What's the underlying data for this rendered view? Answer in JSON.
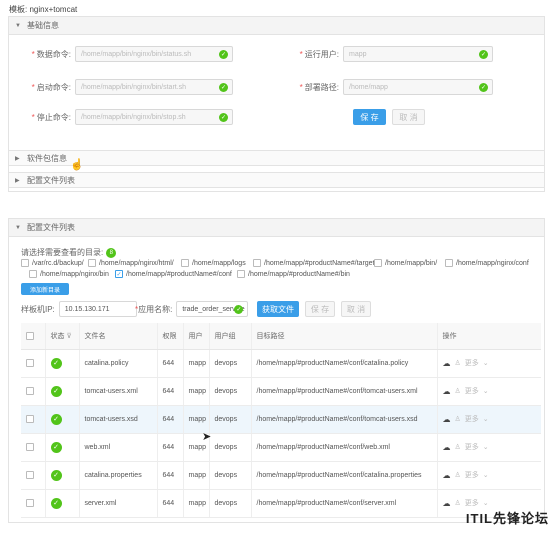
{
  "template": {
    "title": "模板: nginx+tomcat"
  },
  "basic_info": {
    "title": "基础信息",
    "fields": {
      "status_cmd": {
        "label": "数据命令:",
        "value": "/home/mapp/bin/nginx/bin/status.sh"
      },
      "start_cmd": {
        "label": "启动命令:",
        "value": "/home/mapp/bin/nginx/bin/start.sh"
      },
      "stop_cmd": {
        "label": "停止命令:",
        "value": "/home/mapp/bin/nginx/bin/stop.sh"
      },
      "run_user": {
        "label": "运行用户:",
        "value": "mapp"
      },
      "deploy_path": {
        "label": "部署路径:",
        "value": "/home/mapp"
      }
    },
    "save_label": "保 存",
    "cancel_label": "取 消"
  },
  "software_pkg": {
    "title": "软件包信息"
  },
  "config_list_collapsed": {
    "title": "配置文件列表"
  },
  "config_panel": {
    "title": "配置文件列表",
    "dir_hint": "请选择需要查看的目录:",
    "dir_count": "8",
    "dirs": [
      {
        "label": "/var/rc.d/backup/",
        "checked": false
      },
      {
        "label": "/home/mapp/nginx/html/",
        "checked": false
      },
      {
        "label": "/home/mapp/logs",
        "checked": false
      },
      {
        "label": "/home/mapp/#productName#/target",
        "checked": false
      },
      {
        "label": "/home/mapp/bin/",
        "checked": false
      },
      {
        "label": "/home/mapp/nginx/conf",
        "checked": false
      },
      {
        "label": "/home/mapp/nginx/bin",
        "checked": false
      },
      {
        "label": "/home/mapp/#productName#/conf",
        "checked": true
      },
      {
        "label": "/home/mapp/#productName#/bin",
        "checked": false
      }
    ],
    "add_dir_label": "添加新目录",
    "host_ip_label": "样板机IP:",
    "host_ip_value": "10.15.130.171",
    "app_name_label": "应用名称:",
    "app_name_value": "trade_order_service",
    "get_files_label": "获取文件",
    "save_label": "保 存",
    "cancel_label": "取 消",
    "columns": [
      "状态",
      "文件名",
      "权限",
      "用户",
      "用户组",
      "目标路径",
      "操作"
    ],
    "rows": [
      {
        "name": "catalina.policy",
        "perm": "644",
        "user": "mapp",
        "group": "devops",
        "path": "/home/mapp/#productName#/conf/catalina.policy"
      },
      {
        "name": "tomcat-users.xml",
        "perm": "644",
        "user": "mapp",
        "group": "devops",
        "path": "/home/mapp/#productName#/conf/tomcat-users.xml"
      },
      {
        "name": "tomcat-users.xsd",
        "perm": "644",
        "user": "mapp",
        "group": "devops",
        "path": "/home/mapp/#productName#/conf/tomcat-users.xsd"
      },
      {
        "name": "web.xml",
        "perm": "644",
        "user": "mapp",
        "group": "devops",
        "path": "/home/mapp/#productName#/conf/web.xml"
      },
      {
        "name": "catalina.properties",
        "perm": "644",
        "user": "mapp",
        "group": "devops",
        "path": "/home/mapp/#productName#/conf/catalina.properties"
      },
      {
        "name": "server.xml",
        "perm": "644",
        "user": "mapp",
        "group": "devops",
        "path": "/home/mapp/#productName#/conf/server.xml"
      }
    ],
    "row_more": "更多"
  },
  "watermark": "ITIL先锋论坛"
}
